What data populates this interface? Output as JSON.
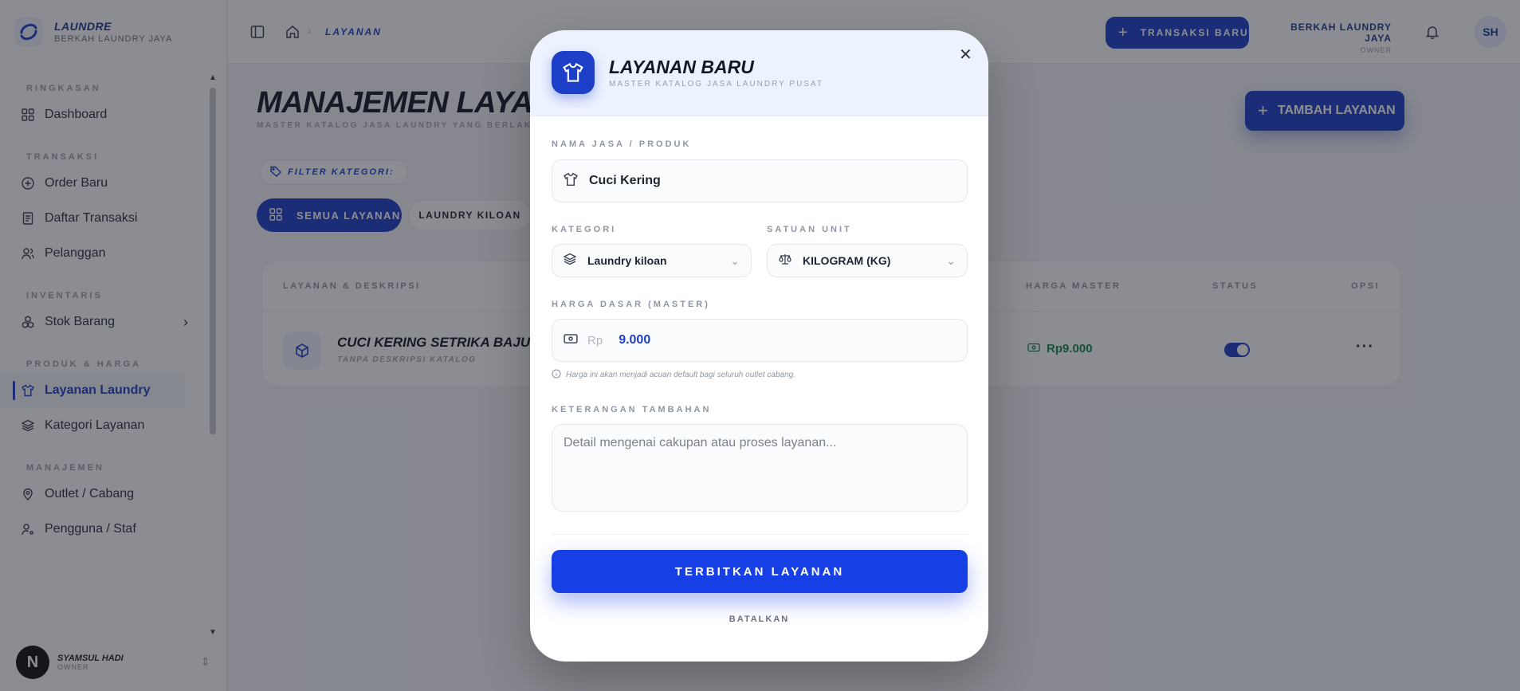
{
  "brand": {
    "name": "LAUNDRE",
    "subtitle": "BERKAH LAUNDRY JAYA"
  },
  "sidebar": {
    "sections": [
      {
        "title": "RINGKASAN",
        "items": [
          {
            "label": "Dashboard",
            "icon": "grid-icon"
          }
        ]
      },
      {
        "title": "TRANSAKSI",
        "items": [
          {
            "label": "Order Baru",
            "icon": "plus-circle-icon"
          },
          {
            "label": "Daftar Transaksi",
            "icon": "receipt-icon"
          },
          {
            "label": "Pelanggan",
            "icon": "users-icon"
          }
        ]
      },
      {
        "title": "INVENTARIS",
        "items": [
          {
            "label": "Stok Barang",
            "icon": "boxes-icon"
          }
        ]
      },
      {
        "title": "PRODUK & HARGA",
        "items": [
          {
            "label": "Layanan Laundry",
            "icon": "shirt-icon",
            "active": true
          },
          {
            "label": "Kategori Layanan",
            "icon": "layers-icon"
          }
        ]
      },
      {
        "title": "MANAJEMEN",
        "items": [
          {
            "label": "Outlet / Cabang",
            "icon": "map-pin-icon"
          },
          {
            "label": "Pengguna / Staf",
            "icon": "user-cog-icon"
          }
        ]
      }
    ],
    "user": {
      "initial": "N",
      "name": "SYAMSUL HADI",
      "role": "OWNER"
    }
  },
  "topbar": {
    "breadcrumb": "LAYANAN",
    "new_transaction": "TRANSAKSI BARU",
    "outlet_name": "BERKAH LAUNDRY JAYA",
    "outlet_role": "OWNER",
    "avatar": "SH"
  },
  "main": {
    "title": "MANAJEMEN LAYANAN",
    "subtitle": "MASTER KATALOG JASA LAUNDRY YANG BERLAKU",
    "add_button": "TAMBAH LAYANAN",
    "filter_label": "FILTER KATEGORI:",
    "chips": {
      "all": "SEMUA LAYANAN",
      "kiloan": "LAUNDRY KILOAN"
    },
    "table": {
      "headers": {
        "service": "LAYANAN & DESKRIPSI",
        "price": "HARGA MASTER",
        "status": "STATUS",
        "options": "OPSI"
      },
      "rows": [
        {
          "name": "CUCI KERING SETRIKA BAJU",
          "description": "TANPA DESKRIPSI KATALOG",
          "price": "Rp9.000",
          "active": true
        }
      ]
    }
  },
  "modal": {
    "title": "LAYANAN BARU",
    "subtitle": "MASTER KATALOG JASA LAUNDRY PUSAT",
    "fields": {
      "name_label": "NAMA JASA / PRODUK",
      "name_value": "Cuci Kering",
      "category_label": "KATEGORI",
      "category_value": "Laundry kiloan",
      "unit_label": "SATUAN UNIT",
      "unit_value": "KILOGRAM (KG)",
      "price_label": "HARGA DASAR (MASTER)",
      "price_prefix": "Rp",
      "price_value": "9.000",
      "price_hint": "Harga ini akan menjadi acuan default bagi seluruh outlet cabang.",
      "notes_label": "KETERANGAN TAMBAHAN",
      "notes_placeholder": "Detail mengenai cakupan atau proses layanan..."
    },
    "submit": "TERBITKAN LAYANAN",
    "cancel": "BATALKAN"
  },
  "colors": {
    "primary": "#1d3fc7",
    "submit": "#1640e5",
    "price_green": "#10884a"
  }
}
